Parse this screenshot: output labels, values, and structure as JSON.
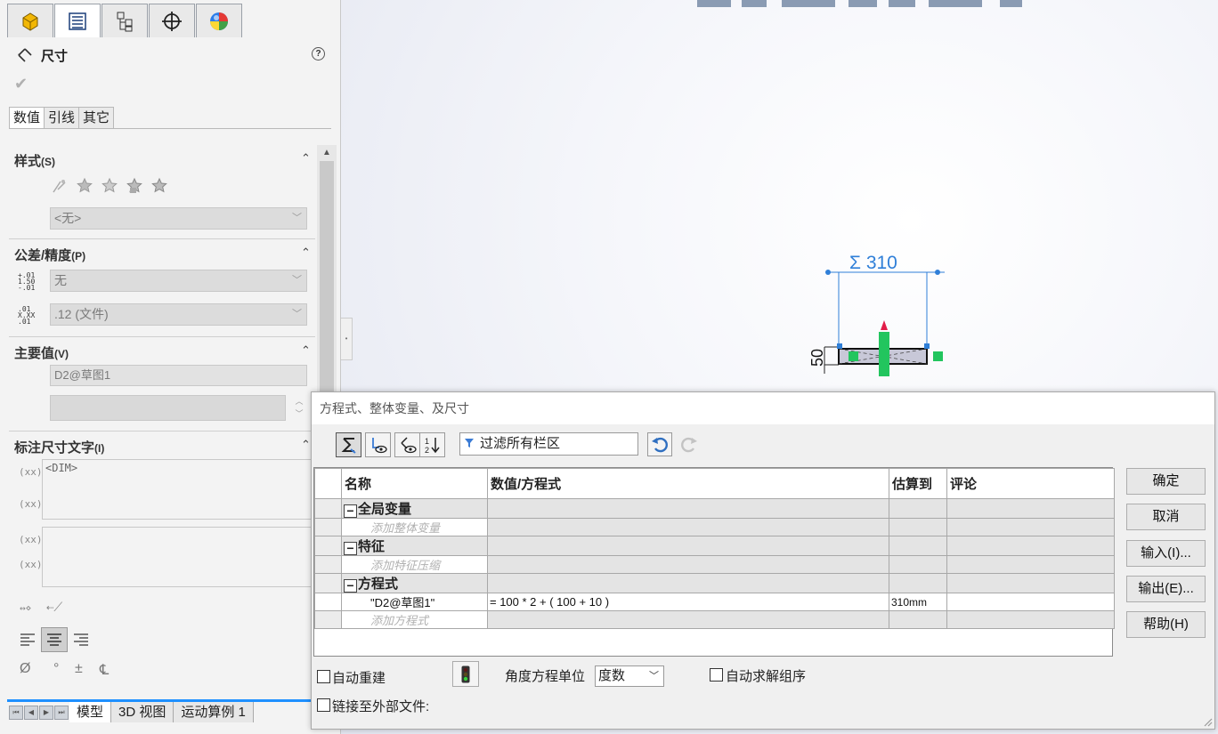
{
  "property_manager": {
    "title": "尺寸",
    "help": "?",
    "subtabs": [
      "数值",
      "引线",
      "其它"
    ],
    "sections": {
      "style": {
        "title": "样式",
        "key": "(S)",
        "combo": "<无>"
      },
      "tolerance": {
        "title": "公差/精度",
        "key": "(P)",
        "tol_combo": "无",
        "prec_combo": ".12 (文件)",
        "tol_icon": [
          "+.01",
          "1.50",
          "-.01"
        ],
        "prec_icon": [
          ".01",
          "X.XX",
          ".01"
        ]
      },
      "primary": {
        "title": "主要值",
        "key": "(V)",
        "name": "D2@草图1",
        "value": ""
      },
      "dim_text": {
        "title": "标注尺寸文字",
        "key": "(I)",
        "text": "<DIM>",
        "icon1": "(xx)",
        "icon2": "(xx)"
      }
    },
    "bottom_tabs": [
      "模型",
      "3D 视图",
      "运动算例 1"
    ]
  },
  "graphics": {
    "dimension_value": "Σ 310",
    "vertical_dim": "50"
  },
  "dialog": {
    "title": "方程式、整体变量、及尺寸",
    "filter_text": "过滤所有栏区",
    "columns": [
      "名称",
      "数值/方程式",
      "估算到",
      "评论"
    ],
    "groups": [
      {
        "name": "全局变量",
        "add_label": "添加整体变量",
        "rows": []
      },
      {
        "name": "特征",
        "add_label": "添加特征压缩",
        "rows": []
      },
      {
        "name": "方程式",
        "add_label": "添加方程式",
        "rows": [
          {
            "name": "\"D2@草图1\"",
            "value": "= 100 * 2 + ( 100 + 10 )",
            "evaluates": "310mm",
            "comment": ""
          }
        ]
      }
    ],
    "buttons": {
      "ok": "确定",
      "cancel": "取消",
      "import": "输入(I)...",
      "export": "输出(E)...",
      "help": "帮助(H)"
    },
    "options": {
      "auto_rebuild": "自动重建",
      "angle_unit_label": "角度方程单位",
      "angle_unit": "度数",
      "auto_solve": "自动求解组序",
      "link_external": "链接至外部文件:"
    }
  },
  "colors": {
    "accent": "#1e90ff",
    "dim_blue": "#2f7fd8",
    "sketch_green": "#22c55e"
  }
}
